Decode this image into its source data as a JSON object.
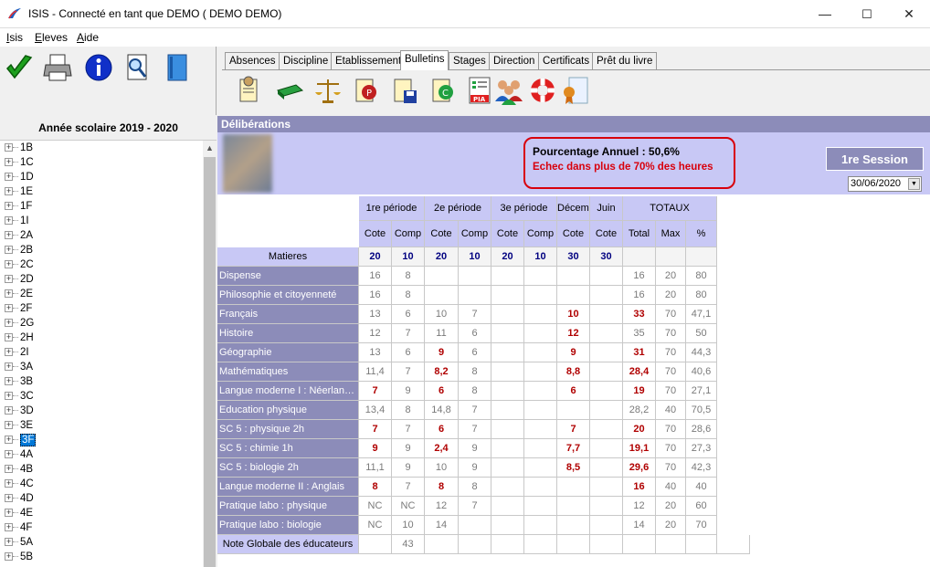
{
  "window": {
    "title": "ISIS - Connecté en tant que DEMO ( DEMO DEMO)",
    "minimize": "—",
    "maximize": "☐",
    "close": "✕"
  },
  "menu": [
    {
      "label": "Isis"
    },
    {
      "label": "Eleves"
    },
    {
      "label": "Aide"
    }
  ],
  "tabs": [
    "Absences",
    "Discipline",
    "Etablissement",
    "Bulletins",
    "Stages",
    "Direction",
    "Certificats",
    "Prêt du livre"
  ],
  "active_tab": "Bulletins",
  "year_label": "Année scolaire 2019 - 2020",
  "classes": [
    "1B",
    "1C",
    "1D",
    "1E",
    "1F",
    "1I",
    "2A",
    "2B",
    "2C",
    "2D",
    "2E",
    "2F",
    "2G",
    "2H",
    "2I",
    "3A",
    "3B",
    "3C",
    "3D",
    "3E",
    "3F",
    "4A",
    "4B",
    "4C",
    "4D",
    "4E",
    "4F",
    "5A",
    "5B"
  ],
  "selected_class": "3F",
  "panel": {
    "title": "Délibérations",
    "percentage": "Pourcentage Annuel : 50,6%",
    "failure": "Echec dans plus de 70% des heures",
    "session": "1re Session",
    "date": "30/06/2020"
  },
  "grid": {
    "period_headers": [
      "1re période",
      "2e période",
      "3e période",
      "Décembre",
      "Juin",
      "TOTAUX"
    ],
    "sub_headers": [
      "Cote",
      "Comp",
      "Cote",
      "Comp",
      "Cote",
      "Comp",
      "Cote",
      "Cote",
      "Total",
      "Max",
      "%"
    ],
    "matieres_label": "Matieres",
    "max_row": [
      "20",
      "10",
      "20",
      "10",
      "20",
      "10",
      "30",
      "30",
      "",
      "",
      ""
    ],
    "rows": [
      {
        "subject": "Dispense",
        "v": [
          "16",
          "8",
          "",
          "",
          "",
          "",
          "",
          "",
          "16",
          "20",
          "80"
        ],
        "red": []
      },
      {
        "subject": "Philosophie et citoyenneté",
        "v": [
          "16",
          "8",
          "",
          "",
          "",
          "",
          "",
          "",
          "16",
          "20",
          "80"
        ],
        "red": []
      },
      {
        "subject": "Français",
        "v": [
          "13",
          "6",
          "10",
          "7",
          "",
          "",
          "10",
          "",
          "33",
          "70",
          "47,1"
        ],
        "red": [
          6,
          8
        ]
      },
      {
        "subject": "Histoire",
        "v": [
          "12",
          "7",
          "11",
          "6",
          "",
          "",
          "12",
          "",
          "35",
          "70",
          "50"
        ],
        "red": [
          6
        ]
      },
      {
        "subject": "Géographie",
        "v": [
          "13",
          "6",
          "9",
          "6",
          "",
          "",
          "9",
          "",
          "31",
          "70",
          "44,3"
        ],
        "red": [
          2,
          6,
          8
        ]
      },
      {
        "subject": "Mathématiques",
        "v": [
          "11,4",
          "7",
          "8,2",
          "8",
          "",
          "",
          "8,8",
          "",
          "28,4",
          "70",
          "40,6"
        ],
        "red": [
          2,
          6,
          8
        ]
      },
      {
        "subject": "Langue moderne I : Néerlandais",
        "v": [
          "7",
          "9",
          "6",
          "8",
          "",
          "",
          "6",
          "",
          "19",
          "70",
          "27,1"
        ],
        "red": [
          0,
          2,
          6,
          8
        ]
      },
      {
        "subject": "Education physique",
        "v": [
          "13,4",
          "8",
          "14,8",
          "7",
          "",
          "",
          "",
          "",
          "28,2",
          "40",
          "70,5"
        ],
        "red": []
      },
      {
        "subject": "SC 5 : physique 2h",
        "v": [
          "7",
          "7",
          "6",
          "7",
          "",
          "",
          "7",
          "",
          "20",
          "70",
          "28,6"
        ],
        "red": [
          0,
          2,
          6,
          8
        ]
      },
      {
        "subject": "SC 5 : chimie 1h",
        "v": [
          "9",
          "9",
          "2,4",
          "9",
          "",
          "",
          "7,7",
          "",
          "19,1",
          "70",
          "27,3"
        ],
        "red": [
          0,
          2,
          6,
          8
        ]
      },
      {
        "subject": "SC 5 : biologie 2h",
        "v": [
          "11,1",
          "9",
          "10",
          "9",
          "",
          "",
          "8,5",
          "",
          "29,6",
          "70",
          "42,3"
        ],
        "red": [
          6,
          8
        ]
      },
      {
        "subject": "Langue moderne II : Anglais",
        "v": [
          "8",
          "7",
          "8",
          "8",
          "",
          "",
          "",
          "",
          "16",
          "40",
          "40"
        ],
        "red": [
          0,
          2,
          8
        ]
      },
      {
        "subject": "Pratique labo : physique",
        "v": [
          "NC",
          "NC",
          "12",
          "7",
          "",
          "",
          "",
          "",
          "12",
          "20",
          "60"
        ],
        "red": []
      },
      {
        "subject": "Pratique labo : biologie",
        "v": [
          "NC",
          "10",
          "14",
          "",
          "",
          "",
          "",
          "",
          "14",
          "20",
          "70"
        ],
        "red": []
      }
    ],
    "footer_label": "Note Globale des éducateurs",
    "footer_value": "43"
  },
  "colors": {
    "header_bg": "#c8c8f5",
    "subject_bg": "#8c8cb9",
    "alert": "#d8000c"
  }
}
